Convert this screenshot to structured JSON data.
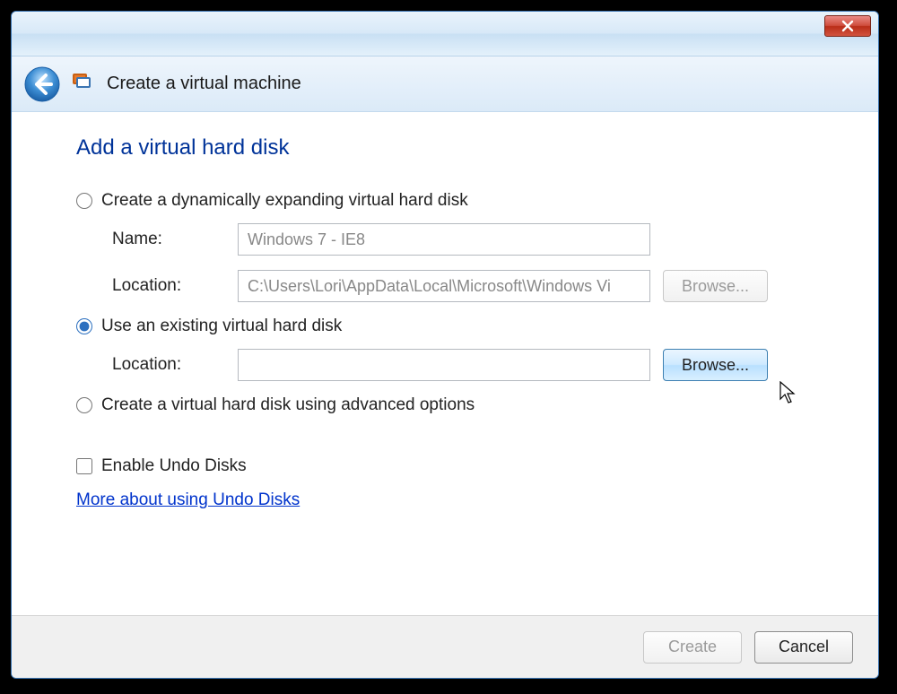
{
  "window": {
    "title": "Create a virtual machine"
  },
  "page": {
    "heading": "Add a virtual hard disk"
  },
  "options": {
    "dynamic": {
      "label": "Create a dynamically expanding virtual hard disk",
      "name_label": "Name:",
      "name_value": "Windows 7 - IE8",
      "location_label": "Location:",
      "location_value": "C:\\Users\\Lori\\AppData\\Local\\Microsoft\\Windows Vi",
      "browse_label": "Browse..."
    },
    "existing": {
      "label": "Use an existing virtual hard disk",
      "location_label": "Location:",
      "location_value": "",
      "browse_label": "Browse..."
    },
    "advanced": {
      "label": "Create a virtual hard disk using advanced options"
    }
  },
  "undo": {
    "checkbox_label": "Enable Undo Disks",
    "link_label": "More about using Undo Disks"
  },
  "footer": {
    "create_label": "Create",
    "cancel_label": "Cancel"
  }
}
